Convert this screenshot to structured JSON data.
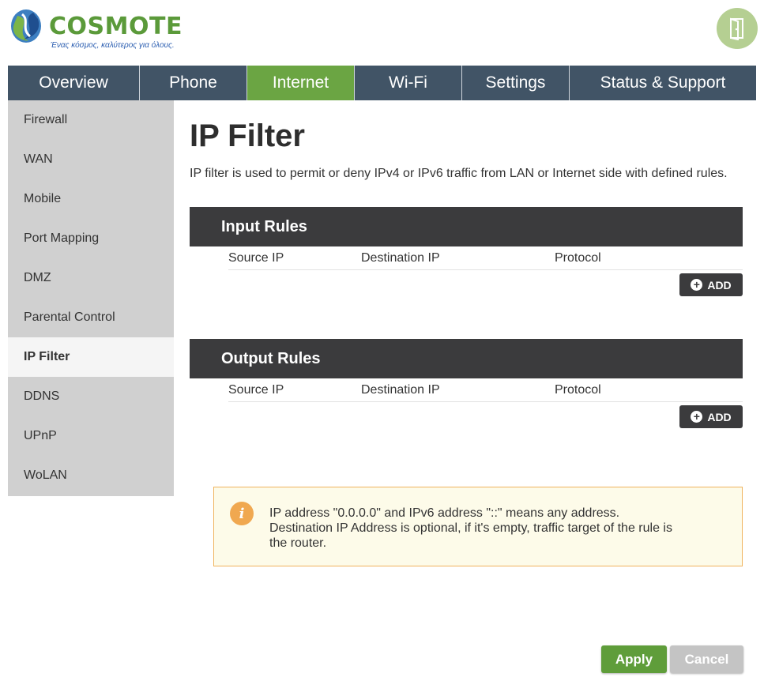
{
  "brand": {
    "name": "COSMOTE",
    "tagline": "Ένας κόσμος, καλύτερος για όλους."
  },
  "colors": {
    "nav_bg": "#415466",
    "accent_green": "#6ba543",
    "sidebar_bg": "#d0d0d0",
    "rules_header_bg": "#3b3b3d",
    "note_border": "#f0b35e",
    "note_bg": "#fdfbe9"
  },
  "header": {
    "logout_icon": "door-exit-icon"
  },
  "nav": {
    "tabs": [
      {
        "label": "Overview"
      },
      {
        "label": "Phone"
      },
      {
        "label": "Internet",
        "active": true
      },
      {
        "label": "Wi-Fi"
      },
      {
        "label": "Settings"
      },
      {
        "label": "Status & Support"
      }
    ]
  },
  "sidebar": {
    "items": [
      {
        "label": "Firewall"
      },
      {
        "label": "WAN"
      },
      {
        "label": "Mobile"
      },
      {
        "label": "Port Mapping"
      },
      {
        "label": "DMZ"
      },
      {
        "label": "Parental Control"
      },
      {
        "label": "IP Filter",
        "active": true
      },
      {
        "label": "DDNS"
      },
      {
        "label": "UPnP"
      },
      {
        "label": "WoLAN"
      }
    ]
  },
  "main": {
    "title": "IP Filter",
    "description": "IP filter is used to permit or deny IPv4 or IPv6 traffic from LAN or Internet side with defined rules.",
    "input_rules": {
      "title": "Input Rules",
      "columns": [
        "Source IP",
        "Destination IP",
        "Protocol"
      ],
      "add_label": "ADD"
    },
    "output_rules": {
      "title": "Output Rules",
      "columns": [
        "Source IP",
        "Destination IP",
        "Protocol"
      ],
      "add_label": "ADD"
    },
    "note": {
      "icon": "info-icon",
      "line1": "IP address \"0.0.0.0\" and IPv6 address \"::\" means any address.",
      "line2": "Destination IP Address is optional, if it's empty, traffic target of the rule is",
      "line3": "the router."
    }
  },
  "footer": {
    "apply_label": "Apply",
    "cancel_label": "Cancel"
  }
}
